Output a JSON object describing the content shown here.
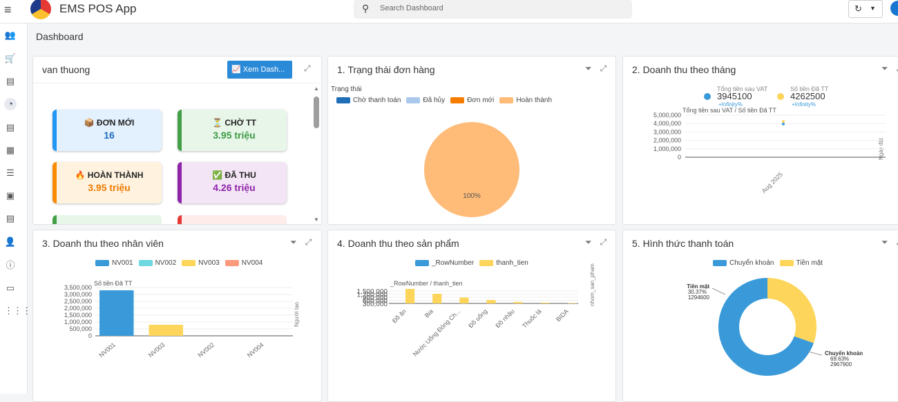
{
  "app": {
    "title": "EMS POS App",
    "search_placeholder": "Search Dashboard",
    "breadcrumb": "Dashboard"
  },
  "panels": {
    "p0": {
      "title": "van thuong",
      "button": "Xem Dash...",
      "cards": [
        {
          "icon": "📦",
          "label": "ĐƠN MỚI",
          "value": "16",
          "color": "#2196f3",
          "bg": "#e3f0fd",
          "valcolor": "#1e6fbf"
        },
        {
          "icon": "⏳",
          "label": "CHỜ TT",
          "value": "3.95 triệu",
          "color": "#43a047",
          "bg": "#e8f5e9",
          "valcolor": "#3b9b43"
        },
        {
          "icon": "🔥",
          "label": "HOÀN THÀNH",
          "value": "3.95 triệu",
          "color": "#fb8c00",
          "bg": "#fff3e0",
          "valcolor": "#ef7a00"
        },
        {
          "icon": "✅",
          "label": "ĐÃ THU",
          "value": "4.26 triệu",
          "color": "#8e24aa",
          "bg": "#f3e5f5",
          "valcolor": "#8e24aa"
        }
      ]
    },
    "p1": {
      "title": "1. Trạng thái đơn hàng",
      "legend_title": "Trạng thái",
      "legend": [
        {
          "name": "Chờ thanh toán",
          "color": "#1f6fb8"
        },
        {
          "name": "Đã hủy",
          "color": "#a9c8ec"
        },
        {
          "name": "Đơn mới",
          "color": "#f57c00"
        },
        {
          "name": "Hoàn thành",
          "color": "#ffbb78"
        }
      ]
    },
    "p2": {
      "title": "2. Doanh thu theo tháng"
    },
    "p3": {
      "title": "3. Doanh thu theo nhân viên"
    },
    "p4": {
      "title": "4. Doanh thu theo sản phẩm"
    },
    "p5": {
      "title": "5. Hình thức thanh toán"
    }
  },
  "chart_data": [
    {
      "type": "pie",
      "title": "",
      "legend_title": "Trạng thái",
      "categories": [
        "Chờ thanh toán",
        "Đã hủy",
        "Đơn mới",
        "Hoàn thành"
      ],
      "values": [
        0,
        0,
        0,
        100
      ],
      "labels": [
        "100%"
      ]
    },
    {
      "type": "scatter",
      "ylabel": "Tổng tiền sau VAT / Số tiền Đã TT",
      "xlabel": "Ngày đặt",
      "categories": [
        "Aug 2025"
      ],
      "series": [
        {
          "name": "Tổng tiền sau VAT",
          "values": [
            3945100
          ],
          "color": "#3a9ad9",
          "summary": "3945100",
          "change": "+Infinity%"
        },
        {
          "name": "Số tiền Đã TT",
          "values": [
            4262500
          ],
          "color": "#fdd55a",
          "summary": "4262500",
          "change": "+Infinity%"
        }
      ],
      "yticks": [
        "5,000,000",
        "4,000,000",
        "3,000,000",
        "2,000,000",
        "1,000,000",
        "0"
      ],
      "ylim": [
        0,
        5000000
      ]
    },
    {
      "type": "bar",
      "ylabel": "Số tiền Đã TT",
      "xlabel": "Người tạo",
      "categories": [
        "NV001",
        "NV003",
        "NV002",
        "NV004"
      ],
      "legend": [
        {
          "name": "NV001",
          "color": "#3a9ad9"
        },
        {
          "name": "NV002",
          "color": "#6ed7e0"
        },
        {
          "name": "NV003",
          "color": "#fdd55a"
        },
        {
          "name": "NV004",
          "color": "#fb9a7c"
        }
      ],
      "values": [
        3300000,
        800000,
        0,
        0
      ],
      "colors": [
        "#3a9ad9",
        "#fdd55a",
        "#6ed7e0",
        "#fb9a7c"
      ],
      "yticks": [
        "3,500,000",
        "3,000,000",
        "2,500,000",
        "2,000,000",
        "1,500,000",
        "1,000,000",
        "500,000",
        "0"
      ],
      "ylim": [
        0,
        3500000
      ]
    },
    {
      "type": "bar",
      "ylabel": "_RowNumber / thanh_tien",
      "xlabel": "nhom_san_pham",
      "categories": [
        "Đồ ăn",
        "Bia",
        "Nước Uống Đóng Ch...",
        "Đồ uống",
        "Đồ nhậu",
        "Thuốc lá",
        "BIDA"
      ],
      "series": [
        {
          "name": "_RowNumber",
          "color": "#3a9ad9",
          "values": [
            0,
            0,
            0,
            0,
            0,
            0,
            0
          ]
        },
        {
          "name": "thanh_tien",
          "color": "#fdd55a",
          "values": [
            1500000,
            1000000,
            600000,
            350000,
            150000,
            80000,
            40000
          ]
        }
      ],
      "yticks": [
        "1,500,000",
        "1,200,000",
        "900,000",
        "600,000",
        "300,000"
      ]
    },
    {
      "type": "pie",
      "categories": [
        "Chuyển khoản",
        "Tiền mặt"
      ],
      "values": [
        2967900,
        1294600
      ],
      "percents": [
        "69.63%",
        "30.37%"
      ],
      "colors": [
        "#3a9ad9",
        "#fdd55a"
      ]
    }
  ]
}
